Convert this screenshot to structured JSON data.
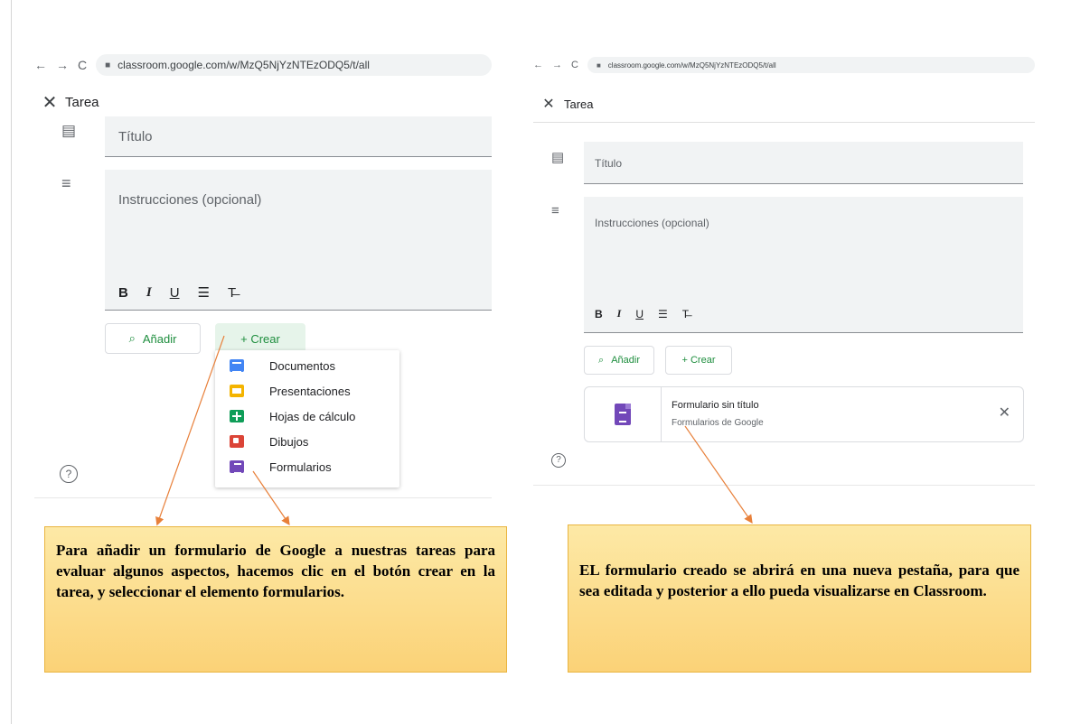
{
  "left": {
    "url": "classroom.google.com/w/MzQ5NjYzNTEzODQ5/t/all",
    "title": "Tarea",
    "title_placeholder": "Título",
    "instructions_placeholder": "Instrucciones (opcional)",
    "add_label": "Añadir",
    "create_label": "+ Crear",
    "menu": [
      "Documentos",
      "Presentaciones",
      "Hojas de cálculo",
      "Dibujos",
      "Formularios"
    ]
  },
  "right": {
    "url": "classroom.google.com/w/MzQ5NjYzNTEzODQ5/t/all",
    "title": "Tarea",
    "title_placeholder": "Título",
    "instructions_placeholder": "Instrucciones (opcional)",
    "add_label": "Añadir",
    "create_label": "+ Crear",
    "attachment_title": "Formulario sin título",
    "attachment_subtitle": "Formularios de Google"
  },
  "notes": {
    "left": "Para añadir un formulario de Google a nuestras tareas para evaluar algunos aspectos, hacemos clic en el botón crear en la tarea, y seleccionar el elemento formularios.",
    "right": "EL formulario creado se abrirá en una nueva pestaña, para que sea editada y posterior a ello pueda visualizarse en Classroom."
  },
  "glyphs": {
    "back": "←",
    "forward": "→",
    "reload": "C",
    "lock": "🔒",
    "close": "✕",
    "title_icon": "▤",
    "notes_icon": "≡",
    "help": "?",
    "bold": "B",
    "italic": "I",
    "underline": "U",
    "list": "☰",
    "clear": "T̶",
    "paperclip": "⌀"
  },
  "colors": {
    "accent_green": "#1e8e3e",
    "note_fill": "#fbd277",
    "arrow": "#e8803a"
  }
}
